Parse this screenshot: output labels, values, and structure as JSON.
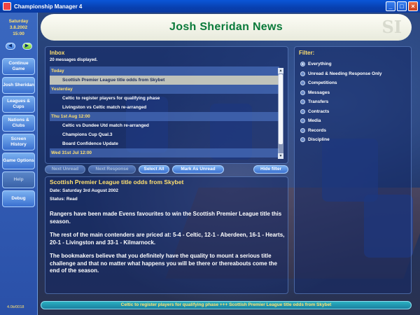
{
  "window": {
    "title": "Championship Manager 4"
  },
  "sidebar": {
    "day": "Saturday",
    "date": "3.8.2002",
    "time": "15:00",
    "items": [
      {
        "label": "Continue Game"
      },
      {
        "label": "Josh Sheridan"
      },
      {
        "label": "Leagues & Cups"
      },
      {
        "label": "Nations & Clubs"
      },
      {
        "label": "Screen History"
      },
      {
        "label": "Game Options"
      },
      {
        "label": "Help"
      },
      {
        "label": "Debug"
      }
    ],
    "version": "4.0b/0018"
  },
  "header": {
    "title": "Josh Sheridan News"
  },
  "inbox": {
    "title": "Inbox",
    "count": "20 messages displayed.",
    "rows": [
      {
        "type": "group",
        "text": "Today"
      },
      {
        "type": "item",
        "text": "Scottish Premier League title odds from Skybet",
        "selected": true
      },
      {
        "type": "group",
        "text": "Yesterday"
      },
      {
        "type": "item",
        "text": "Celtic to register players for qualifying phase"
      },
      {
        "type": "item",
        "text": "Livingston vs Celtic match re-arranged"
      },
      {
        "type": "group",
        "text": "Thu 1st Aug 12:00"
      },
      {
        "type": "item",
        "text": "Celtic vs Dundee Utd match re-arranged"
      },
      {
        "type": "item",
        "text": "Champions Cup Qual.3"
      },
      {
        "type": "item",
        "text": "Board Confidence Update"
      },
      {
        "type": "group",
        "text": "Wed 31st Jul 12:00"
      }
    ]
  },
  "actions": {
    "next_unread": "Next Unread",
    "next_response": "Next Response",
    "select_all": "Select All",
    "mark_unread": "Mark As Unread",
    "hide_filter": "Hide filter"
  },
  "message": {
    "subject": "Scottish Premier League title odds from Skybet",
    "date": "Date: Saturday 3rd August 2002",
    "status": "Status: Read",
    "paragraphs": [
      "Rangers have been made Evens favourites to win the Scottish Premier League title this season.",
      "The rest of the main contenders are priced at: 5-4 - Celtic, 12-1 - Aberdeen, 16-1 - Hearts, 20-1 - Livingston and 33-1 - Kilmarnock.",
      "The bookmakers believe that you definitely have the quality to mount a serious title challenge and that no matter what happens you will be there or thereabouts come the end of the season."
    ]
  },
  "filter": {
    "title": "Filter:",
    "options": [
      {
        "label": "Everything",
        "selected": true
      },
      {
        "label": "Unread & Needing Response Only"
      },
      {
        "label": "Competitions"
      },
      {
        "label": "Messages"
      },
      {
        "label": "Transfers"
      },
      {
        "label": "Contracts"
      },
      {
        "label": "Media"
      },
      {
        "label": "Records"
      },
      {
        "label": "Discipline"
      }
    ]
  },
  "ticker": {
    "text": "Celtic to register players for qualifying phase  +++  Scottish Premier League title odds from Skybet"
  },
  "colors": {
    "accent_yellow": "#ffe070",
    "title_green": "#0a7a3a",
    "panel_blue": "#1b2f5c"
  }
}
